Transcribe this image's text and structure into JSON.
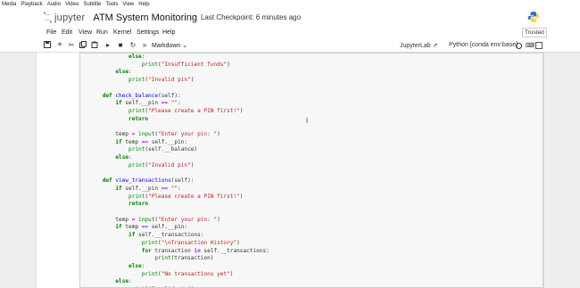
{
  "os_menu": [
    "Media",
    "Playback",
    "Audio",
    "Video",
    "Subtitle",
    "Tools",
    "View",
    "Help"
  ],
  "header": {
    "logo_text": "jupyter",
    "notebook_title": "ATM System Monitoring",
    "checkpoint": "Last Checkpoint: 6 minutes ago"
  },
  "menu": [
    "File",
    "Edit",
    "View",
    "Run",
    "Kernel",
    "Settings",
    "Help"
  ],
  "trusted": "Trusted",
  "toolbar": {
    "icons": [
      "save-icon",
      "add-cell-icon",
      "cut-icon",
      "copy-icon",
      "paste-icon",
      "run-icon",
      "stop-icon",
      "restart-icon",
      "fast-forward-icon"
    ],
    "cell_type": "Markdown",
    "jupyterlab": "JupyterLab",
    "kernel": "Python [conda env:base]"
  },
  "code_lines": [
    {
      "indent": "            ",
      "parts": [
        {
          "t": "else",
          "c": "kw"
        },
        {
          "t": ":",
          "c": ""
        }
      ]
    },
    {
      "indent": "                ",
      "parts": [
        {
          "t": "print",
          "c": "bi"
        },
        {
          "t": "(",
          "c": ""
        },
        {
          "t": "\"Insufficient funds\"",
          "c": "str"
        },
        {
          "t": ")",
          "c": ""
        }
      ]
    },
    {
      "indent": "        ",
      "parts": [
        {
          "t": "else",
          "c": "kw"
        },
        {
          "t": ":",
          "c": ""
        }
      ]
    },
    {
      "indent": "            ",
      "parts": [
        {
          "t": "print",
          "c": "bi"
        },
        {
          "t": "(",
          "c": ""
        },
        {
          "t": "\"Invalid pin\"",
          "c": "str"
        },
        {
          "t": ")",
          "c": ""
        }
      ]
    },
    {
      "indent": "",
      "parts": []
    },
    {
      "indent": "    ",
      "parts": [
        {
          "t": "def",
          "c": "kw"
        },
        {
          "t": " ",
          "c": ""
        },
        {
          "t": "check_balance",
          "c": "fn"
        },
        {
          "t": "(self):",
          "c": ""
        }
      ]
    },
    {
      "indent": "        ",
      "parts": [
        {
          "t": "if",
          "c": "kw"
        },
        {
          "t": " self.__pin ",
          "c": ""
        },
        {
          "t": "==",
          "c": "op"
        },
        {
          "t": " ",
          "c": ""
        },
        {
          "t": "\"\"",
          "c": "str"
        },
        {
          "t": ":",
          "c": ""
        }
      ]
    },
    {
      "indent": "            ",
      "parts": [
        {
          "t": "print",
          "c": "bi"
        },
        {
          "t": "(",
          "c": ""
        },
        {
          "t": "\"Please create a PIN first!\"",
          "c": "str"
        },
        {
          "t": ")",
          "c": ""
        }
      ]
    },
    {
      "indent": "            ",
      "parts": [
        {
          "t": "return",
          "c": "kw"
        }
      ]
    },
    {
      "indent": "",
      "parts": []
    },
    {
      "indent": "        ",
      "parts": [
        {
          "t": "temp ",
          "c": ""
        },
        {
          "t": "=",
          "c": "op"
        },
        {
          "t": " ",
          "c": ""
        },
        {
          "t": "input",
          "c": "bi"
        },
        {
          "t": "(",
          "c": ""
        },
        {
          "t": "\"Enter your pin: \"",
          "c": "str"
        },
        {
          "t": ")",
          "c": ""
        }
      ]
    },
    {
      "indent": "        ",
      "parts": [
        {
          "t": "if",
          "c": "kw"
        },
        {
          "t": " temp ",
          "c": ""
        },
        {
          "t": "==",
          "c": "op"
        },
        {
          "t": " self.__pin:",
          "c": ""
        }
      ]
    },
    {
      "indent": "            ",
      "parts": [
        {
          "t": "print",
          "c": "bi"
        },
        {
          "t": "(self.__balance)",
          "c": ""
        }
      ]
    },
    {
      "indent": "        ",
      "parts": [
        {
          "t": "else",
          "c": "kw"
        },
        {
          "t": ":",
          "c": ""
        }
      ]
    },
    {
      "indent": "            ",
      "parts": [
        {
          "t": "print",
          "c": "bi"
        },
        {
          "t": "(",
          "c": ""
        },
        {
          "t": "\"Invalid pin\"",
          "c": "str"
        },
        {
          "t": ")",
          "c": ""
        }
      ]
    },
    {
      "indent": "",
      "parts": []
    },
    {
      "indent": "    ",
      "parts": [
        {
          "t": "def",
          "c": "kw"
        },
        {
          "t": " ",
          "c": ""
        },
        {
          "t": "view_transactions",
          "c": "fn"
        },
        {
          "t": "(self):",
          "c": ""
        }
      ]
    },
    {
      "indent": "        ",
      "parts": [
        {
          "t": "if",
          "c": "kw"
        },
        {
          "t": " self.__pin ",
          "c": ""
        },
        {
          "t": "==",
          "c": "op"
        },
        {
          "t": " ",
          "c": ""
        },
        {
          "t": "\"\"",
          "c": "str"
        },
        {
          "t": ":",
          "c": ""
        }
      ]
    },
    {
      "indent": "            ",
      "parts": [
        {
          "t": "print",
          "c": "bi"
        },
        {
          "t": "(",
          "c": ""
        },
        {
          "t": "\"Please create a PIN first!\"",
          "c": "str"
        },
        {
          "t": ")",
          "c": ""
        }
      ]
    },
    {
      "indent": "            ",
      "parts": [
        {
          "t": "return",
          "c": "kw"
        }
      ]
    },
    {
      "indent": "",
      "parts": []
    },
    {
      "indent": "        ",
      "parts": [
        {
          "t": "temp ",
          "c": ""
        },
        {
          "t": "=",
          "c": "op"
        },
        {
          "t": " ",
          "c": ""
        },
        {
          "t": "input",
          "c": "bi"
        },
        {
          "t": "(",
          "c": ""
        },
        {
          "t": "\"Enter your pin: \"",
          "c": "str"
        },
        {
          "t": ")",
          "c": ""
        }
      ]
    },
    {
      "indent": "        ",
      "parts": [
        {
          "t": "if",
          "c": "kw"
        },
        {
          "t": " temp ",
          "c": ""
        },
        {
          "t": "==",
          "c": "op"
        },
        {
          "t": " self.__pin:",
          "c": ""
        }
      ]
    },
    {
      "indent": "            ",
      "parts": [
        {
          "t": "if",
          "c": "kw"
        },
        {
          "t": " self.__transactions:",
          "c": ""
        }
      ]
    },
    {
      "indent": "                ",
      "parts": [
        {
          "t": "print",
          "c": "bi"
        },
        {
          "t": "(",
          "c": ""
        },
        {
          "t": "\"\\nTransaction History\"",
          "c": "str"
        },
        {
          "t": ")",
          "c": ""
        }
      ]
    },
    {
      "indent": "                ",
      "parts": [
        {
          "t": "for",
          "c": "kw"
        },
        {
          "t": " transaction ",
          "c": ""
        },
        {
          "t": "in",
          "c": "op"
        },
        {
          "t": " self.__transactions:",
          "c": ""
        }
      ]
    },
    {
      "indent": "                    ",
      "parts": [
        {
          "t": "print",
          "c": "bi"
        },
        {
          "t": "(transaction)",
          "c": ""
        }
      ]
    },
    {
      "indent": "            ",
      "parts": [
        {
          "t": "else",
          "c": "kw"
        },
        {
          "t": ":",
          "c": ""
        }
      ]
    },
    {
      "indent": "                ",
      "parts": [
        {
          "t": "print",
          "c": "bi"
        },
        {
          "t": "(",
          "c": ""
        },
        {
          "t": "\"No transactions yet\"",
          "c": "str"
        },
        {
          "t": ")",
          "c": ""
        }
      ]
    },
    {
      "indent": "        ",
      "parts": [
        {
          "t": "else",
          "c": "kw"
        },
        {
          "t": ":",
          "c": ""
        }
      ]
    },
    {
      "indent": "            ",
      "parts": [
        {
          "t": "print",
          "c": "bi"
        },
        {
          "t": "(",
          "c": ""
        },
        {
          "t": "\"Invalid pin\"",
          "c": "str"
        },
        {
          "t": ")",
          "c": ""
        }
      ]
    }
  ],
  "colors": {
    "accent_orange": "#f37726",
    "keyword_green": "#008000",
    "string_red": "#ba2121",
    "function_blue": "#0000ff"
  }
}
